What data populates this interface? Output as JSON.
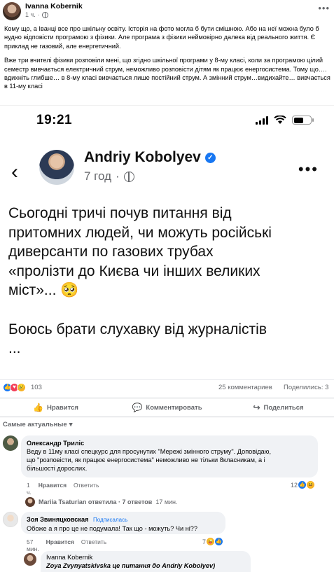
{
  "post": {
    "author": "Ivanna Kobernik",
    "time": "1 ч.",
    "more_icon": "more-horizontal-icon",
    "paragraphs": [
      "Кому що, а Іванці все про шкільну освіту. Історія на фото могла б бути смішною. Або на неї можна було б нудно відповісти програмою з фізики. Але програма з фізики неймовірно далека від реального життя. Є приклад не газовий, але енергетичний.",
      "Вже три вчителі фізики розповіли мені, що згідно шкільної програми  у 8-му класі, коли за програмою цілий семестр вивчається електричний струм, неможливо розповісти дітям як працює енергосистема. Тому що…. вдихніть глибше… в 8-му класі вивчається лише постійний струм. А змінний струм…видихайте… вивчається в 11-му класі"
    ]
  },
  "screenshot": {
    "time": "19:21",
    "author": "Andriy Kobolyev",
    "meta_time": "7 год",
    "text_lines": [
      "Сьогодні тричі почув питання від",
      "притомних людей, чи можуть російські",
      "диверсанти по газових трубах",
      "«пролізти до Києва чи інших великих",
      "міст»... 🥺"
    ],
    "text2_lines": [
      "Боюсь брати слухавку від журналістів",
      "..."
    ]
  },
  "stats": {
    "reactions": "103",
    "comments": "25 комментариев",
    "shares": "Поделились: 3"
  },
  "actions": {
    "like": "Нравится",
    "comment": "Комментировать",
    "share": "Поделиться"
  },
  "sort_label": "Самые актуальные",
  "comments": [
    {
      "name": "Олександр Триліс",
      "lines": [
        "Веду в 11му класі спецкурс для просунутих \"Мережі змінного струму\". Доповідаю,",
        "що \"розповісти, як працює енергосистема\" неможливо не тільки 8класникам, а і",
        "більшості дорослих."
      ],
      "time": "1 ч.",
      "like": "Нравится",
      "reply": "Ответить",
      "reactions": "12"
    },
    {
      "reply_summary": "Mariia Tsaturian ответила · 7 ответов",
      "reply_time": "17 мин."
    },
    {
      "name": "Зоя Звиняцковская",
      "badge": "Подписалась",
      "lines": [
        "Обоже а я про це не подумала! Так що - можуть? Чи ні??"
      ],
      "time": "57 мин.",
      "like": "Нравится",
      "reply": "Ответить",
      "reactions": "7"
    },
    {
      "name": "Ivanna Kobernik",
      "text": "Zoya Zvynyatskivska це питання до Andriy Kobolyev)"
    }
  ],
  "colors": {
    "accent": "#1877f2",
    "muted": "#65676b",
    "bubble": "#f0f2f5"
  }
}
